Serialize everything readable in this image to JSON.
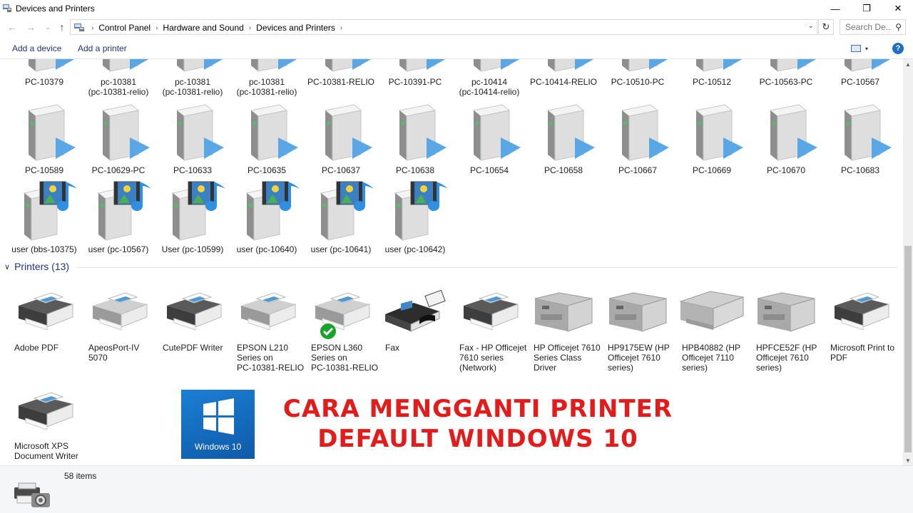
{
  "window": {
    "title": "Devices and Printers",
    "min_glyph": "—",
    "max_glyph": "❐",
    "close_glyph": "✕"
  },
  "nav": {
    "back_glyph": "←",
    "forward_glyph": "→",
    "recent_glyph": "⌄",
    "up_glyph": "↑",
    "breadcrumbs": [
      "Control Panel",
      "Hardware and Sound",
      "Devices and Printers"
    ],
    "crumb_sep": "›",
    "dropdown_glyph": "⌄",
    "refresh_glyph": "↻",
    "search_placeholder": "Search De...",
    "search_glyph": "⚲"
  },
  "commands": {
    "add_device": "Add a device",
    "add_printer": "Add a printer",
    "help_glyph": "?",
    "view_glyph": "▾"
  },
  "devices_row1": [
    {
      "label": "PC-10379"
    },
    {
      "label": "pc-10381\n(pc-10381-relio)"
    },
    {
      "label": "pc-10381\n(pc-10381-relio)"
    },
    {
      "label": "pc-10381\n(pc-10381-relio)"
    },
    {
      "label": "PC-10381-RELIO"
    },
    {
      "label": "PC-10391-PC"
    },
    {
      "label": "pc-10414\n(pc-10414-relio)"
    },
    {
      "label": "PC-10414-RELIO"
    },
    {
      "label": "PC-10510-PC"
    },
    {
      "label": "PC-10512"
    },
    {
      "label": "PC-10563-PC"
    },
    {
      "label": "PC-10567"
    }
  ],
  "devices_row2": [
    {
      "label": "PC-10589"
    },
    {
      "label": "PC-10629-PC"
    },
    {
      "label": "PC-10633"
    },
    {
      "label": "PC-10635"
    },
    {
      "label": "PC-10637"
    },
    {
      "label": "PC-10638"
    },
    {
      "label": "PC-10654"
    },
    {
      "label": "PC-10658"
    },
    {
      "label": "PC-10667"
    },
    {
      "label": "PC-10669"
    },
    {
      "label": "PC-10670"
    },
    {
      "label": "PC-10683"
    }
  ],
  "media_devices": [
    {
      "label": "user (bbs-10375)"
    },
    {
      "label": "user (pc-10567)"
    },
    {
      "label": "User (pc-10599)"
    },
    {
      "label": "user (pc-10640)"
    },
    {
      "label": "user (pc-10641)"
    },
    {
      "label": "user (pc-10642)"
    }
  ],
  "printers_group": {
    "title": "Printers (13)",
    "chevron": "∨"
  },
  "printers": [
    {
      "label": "Adobe PDF",
      "kind": "printer-dark"
    },
    {
      "label": "ApeosPort-IV\n5070",
      "kind": "printer-light"
    },
    {
      "label": "CutePDF Writer",
      "kind": "printer-dark"
    },
    {
      "label": "EPSON L210\nSeries on\nPC-10381-RELIO",
      "kind": "printer-light"
    },
    {
      "label": "EPSON L360\nSeries on\nPC-10381-RELIO",
      "kind": "printer-light",
      "default": true
    },
    {
      "label": "Fax",
      "kind": "fax"
    },
    {
      "label": "Fax - HP Officejet\n7610 series\n(Network)",
      "kind": "printer-dark"
    },
    {
      "label": "HP Officejet 7610\nSeries Class\nDriver",
      "kind": "mfp"
    },
    {
      "label": "HP9175EW (HP\nOfficejet 7610\nseries)",
      "kind": "mfp"
    },
    {
      "label": "HPB40882 (HP\nOfficejet 7110\nseries)",
      "kind": "wide"
    },
    {
      "label": "HPFCE52F (HP\nOfficejet 7610\nseries)",
      "kind": "mfp"
    },
    {
      "label": "Microsoft Print to\nPDF",
      "kind": "printer-dark"
    },
    {
      "label": "Microsoft XPS\nDocument Writer",
      "kind": "printer-dark"
    }
  ],
  "status": {
    "item_count": "58 items"
  },
  "overlay": {
    "logo_text": "Windows 10",
    "headline_line1": "CARA MENGGANTI PRINTER",
    "headline_line2": "DEFAULT WINDOWS 10"
  },
  "colors": {
    "link": "#1e3287",
    "banner_red": "#e31b1b",
    "win_blue": "#1b7fd4",
    "default_check": "#1aa32a"
  }
}
